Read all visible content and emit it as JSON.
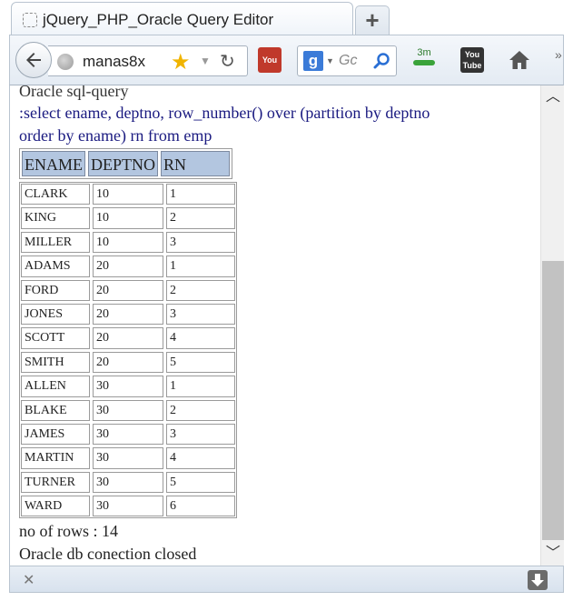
{
  "browser": {
    "tab_title": "jQuery_PHP_Oracle Query Editor",
    "new_tab_label": "+",
    "url": "manas8x",
    "search_placeholder": "Gc",
    "extension_3m": "3m",
    "extension_yt": "You Tube"
  },
  "page": {
    "heading": "Oracle sql-query",
    "query_line1": ":select ename, deptno, row_number() over (partition by deptno",
    "query_line2": "order by ename) rn from emp",
    "columns": [
      "ENAME",
      "DEPTNO",
      "RN"
    ],
    "rows": [
      [
        "CLARK",
        "10",
        "1"
      ],
      [
        "KING",
        "10",
        "2"
      ],
      [
        "MILLER",
        "10",
        "3"
      ],
      [
        "ADAMS",
        "20",
        "1"
      ],
      [
        "FORD",
        "20",
        "2"
      ],
      [
        "JONES",
        "20",
        "3"
      ],
      [
        "SCOTT",
        "20",
        "4"
      ],
      [
        "SMITH",
        "20",
        "5"
      ],
      [
        "ALLEN",
        "30",
        "1"
      ],
      [
        "BLAKE",
        "30",
        "2"
      ],
      [
        "JAMES",
        "30",
        "3"
      ],
      [
        "MARTIN",
        "30",
        "4"
      ],
      [
        "TURNER",
        "30",
        "5"
      ],
      [
        "WARD",
        "30",
        "6"
      ]
    ],
    "row_count_text": "no of rows : 14",
    "connection_text": "Oracle db conection closed"
  },
  "icons": {
    "back": "back-arrow-icon",
    "globe": "globe-icon",
    "bookmark": "star-icon",
    "reload": "reload-icon",
    "search": "magnifier-icon",
    "home": "home-icon",
    "close": "close-icon",
    "download": "download-icon"
  },
  "colors": {
    "query_text": "#1a1a80",
    "header_cell_bg": "#b3c6e0",
    "scroll_thumb": "#c2c2c2"
  }
}
